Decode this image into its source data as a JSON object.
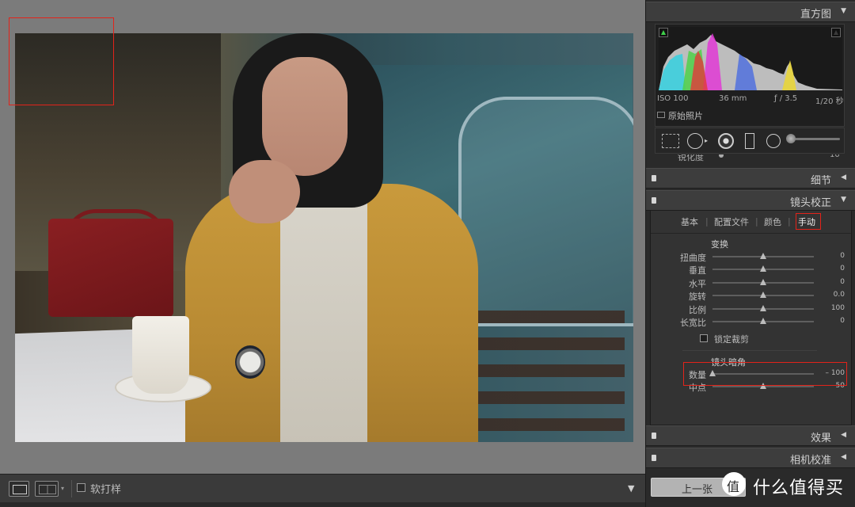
{
  "canvas": {
    "photo_alt": "portrait",
    "toolbar": {
      "softproof_label": "软打样",
      "dropdown_glyph": "▾",
      "menu_glyph": "▼"
    }
  },
  "panel": {
    "histogram": {
      "title": "直方图",
      "arrow": "▼",
      "iso": "ISO 100",
      "focal": "36 mm",
      "aperture": "ƒ / 3.5",
      "shutter": "1/20 秒",
      "original_label": "原始照片"
    },
    "scrolled_row": {
      "label": "锐化度",
      "value": "10"
    },
    "detail": {
      "title": "细节",
      "arrow": "◀"
    },
    "lens": {
      "title": "镜头校正",
      "arrow": "▼",
      "tabs": [
        "基本",
        "配置文件",
        "颜色",
        "手动"
      ],
      "active_tab": 3,
      "transform_title": "变换",
      "transform_sliders": [
        {
          "label": "扭曲度",
          "value": "0",
          "position": 0.5
        },
        {
          "label": "垂直",
          "value": "0",
          "position": 0.5
        },
        {
          "label": "水平",
          "value": "0",
          "position": 0.5
        },
        {
          "label": "旋转",
          "value": "0.0",
          "position": 0.5
        },
        {
          "label": "比例",
          "value": "100",
          "position": 0.5
        },
        {
          "label": "长宽比",
          "value": "0",
          "position": 0.5
        }
      ],
      "lock_crop_label": "锁定裁剪",
      "vignette_title": "镜头暗角",
      "vignette_sliders": [
        {
          "label": "数量",
          "value": "– 100",
          "position": 0.0
        },
        {
          "label": "中点",
          "value": "50",
          "position": 0.5
        }
      ]
    },
    "effects": {
      "title": "效果",
      "arrow": "◀"
    },
    "calibration": {
      "title": "相机校准",
      "arrow": "◀"
    },
    "prev_button": "上一张"
  },
  "watermark": {
    "text": "什么值得买"
  },
  "colors": {
    "highlight": "#e2231a",
    "panel_bg": "#2a2a2a",
    "canvas_bg": "#7b7b7b"
  }
}
